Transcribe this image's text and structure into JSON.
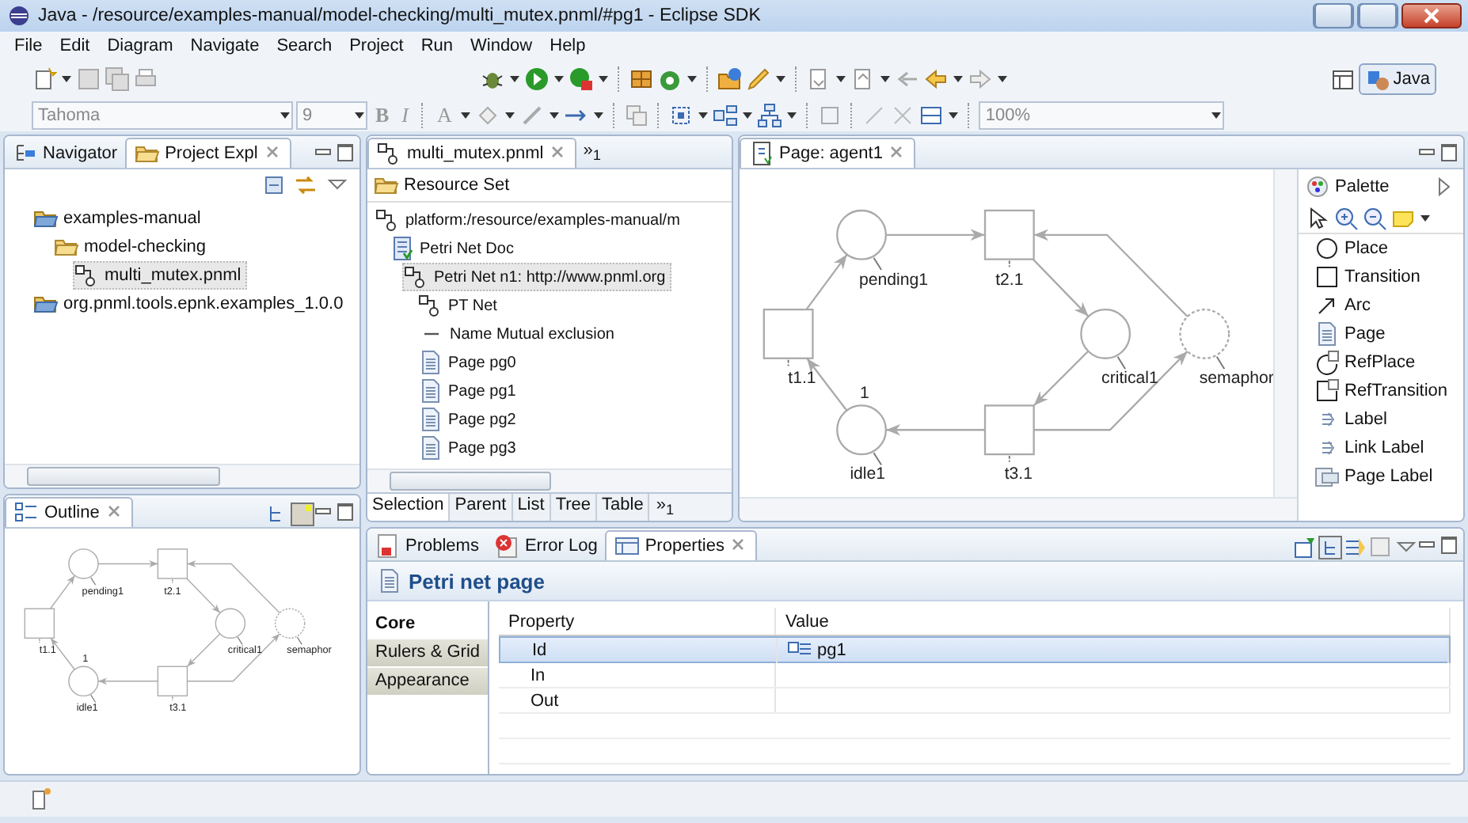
{
  "window": {
    "title": "Java - /resource/examples-manual/model-checking/multi_mutex.pnml/#pg1 - Eclipse SDK"
  },
  "menu": [
    "File",
    "Edit",
    "Diagram",
    "Navigate",
    "Search",
    "Project",
    "Run",
    "Window",
    "Help"
  ],
  "toolbar": {
    "font": "Tahoma",
    "size": "9",
    "bold": "B",
    "italic": "I",
    "font_color": "A",
    "zoom": "100%",
    "perspective": "Java"
  },
  "navigator": {
    "tabs": [
      {
        "label": "Navigator",
        "selected": false
      },
      {
        "label": "Project Expl",
        "selected": true
      }
    ],
    "tree": [
      {
        "label": "examples-manual",
        "kind": "project",
        "selected": false,
        "children": [
          {
            "label": "model-checking",
            "kind": "folder",
            "selected": false,
            "children": [
              {
                "label": "multi_mutex.pnml",
                "kind": "net",
                "selected": true
              }
            ]
          }
        ]
      },
      {
        "label": "org.pnml.tools.epnk.examples_1.0.0",
        "kind": "project",
        "selected": false
      }
    ]
  },
  "outline": {
    "title": "Outline",
    "nodes": [
      {
        "kind": "place",
        "label": "pending1"
      },
      {
        "kind": "transition",
        "label": "t2.1"
      },
      {
        "kind": "transition",
        "label": "t1.1"
      },
      {
        "kind": "place",
        "label": "critical1"
      },
      {
        "kind": "ref_place",
        "label": "semaphor"
      },
      {
        "kind": "place",
        "label": "idle1",
        "marking": "1"
      },
      {
        "kind": "transition",
        "label": "t3.1"
      }
    ]
  },
  "editor": {
    "tab": "multi_mutex.pnml",
    "overflow": "»$_{1}$",
    "header": "Resource Set",
    "tree": [
      {
        "label": "platform:/resource/examples-manual/m",
        "kind": "net",
        "selected": false,
        "children": [
          {
            "label": "Petri Net Doc",
            "kind": "document",
            "selected": false,
            "children": [
              {
                "label": "Petri Net n1: http://www.pnml.org",
                "kind": "net",
                "selected": true,
                "children": [
                  {
                    "label": "PT Net",
                    "kind": "net",
                    "selected": false
                  },
                  {
                    "label": "Name Mutual exclusion",
                    "kind": "name",
                    "selected": false
                  },
                  {
                    "label": "Page pg0",
                    "kind": "page",
                    "selected": false
                  },
                  {
                    "label": "Page pg1",
                    "kind": "page",
                    "selected": false
                  },
                  {
                    "label": "Page pg2",
                    "kind": "page",
                    "selected": false
                  },
                  {
                    "label": "Page pg3",
                    "kind": "page",
                    "selected": false
                  }
                ]
              }
            ]
          }
        ]
      }
    ],
    "bottom_tabs": [
      {
        "label": "Selection",
        "selected": true
      },
      {
        "label": "Parent",
        "selected": false
      },
      {
        "label": "List",
        "selected": false
      },
      {
        "label": "Tree",
        "selected": false
      },
      {
        "label": "Table",
        "selected": false
      }
    ],
    "bottom_overflow": "»$_{1}$"
  },
  "diagram": {
    "tab": "Page: agent1",
    "nodes": [
      {
        "kind": "place",
        "label": "pending1"
      },
      {
        "kind": "transition",
        "label": "t2.1"
      },
      {
        "kind": "transition",
        "label": "t1.1"
      },
      {
        "kind": "place",
        "label": "critical1"
      },
      {
        "kind": "ref_place",
        "label": "semaphor"
      },
      {
        "kind": "place",
        "label": "idle1",
        "marking": "1"
      },
      {
        "kind": "transition",
        "label": "t3.1"
      }
    ]
  },
  "palette": {
    "title": "Palette",
    "tools": [
      {
        "label": "Place",
        "kind": "place"
      },
      {
        "label": "Transition",
        "kind": "transition"
      },
      {
        "label": "Arc",
        "kind": "arc"
      },
      {
        "label": "Page",
        "kind": "page"
      },
      {
        "label": "RefPlace",
        "kind": "ref_place"
      },
      {
        "label": "RefTransition",
        "kind": "ref_transition"
      },
      {
        "label": "Label",
        "kind": "label"
      },
      {
        "label": "Link Label",
        "kind": "label"
      },
      {
        "label": "Page Label",
        "kind": "page_label"
      }
    ]
  },
  "properties": {
    "tabs": [
      {
        "label": "Problems",
        "kind": "problems",
        "selected": false
      },
      {
        "label": "Error Log",
        "kind": "error_log",
        "selected": false
      },
      {
        "label": "Properties",
        "kind": "properties",
        "selected": true
      }
    ],
    "title": "Petri net page",
    "sections": [
      {
        "label": "Core",
        "selected": true
      },
      {
        "label": "Rulers & Grid",
        "selected": false
      },
      {
        "label": "Appearance",
        "selected": false
      }
    ],
    "columns": [
      "Property",
      "Value"
    ],
    "rows": [
      {
        "property": "Id",
        "value": "pg1",
        "selected": true
      },
      {
        "property": "In",
        "selected": false
      },
      {
        "property": "Out",
        "selected": false
      }
    ]
  }
}
